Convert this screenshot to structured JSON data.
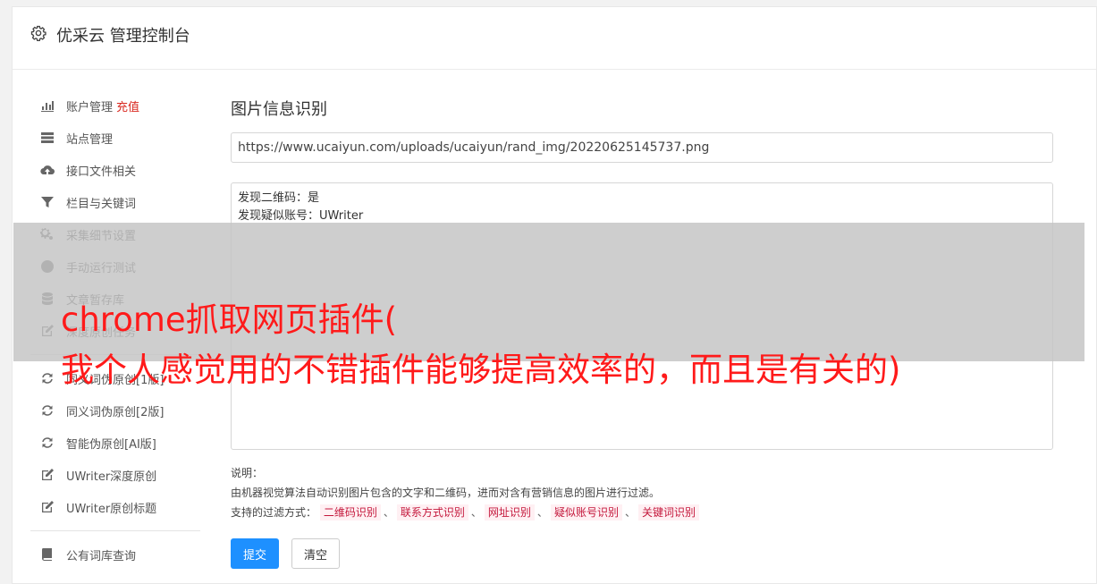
{
  "header": {
    "title": "优采云 管理控制台"
  },
  "sidebar": {
    "group1": [
      {
        "label": "账户管理",
        "badge": "充值",
        "icon": "bar-chart-icon"
      },
      {
        "label": "站点管理",
        "icon": "server-icon"
      },
      {
        "label": "接口文件相关",
        "icon": "cloud-upload-icon"
      },
      {
        "label": "栏目与关键词",
        "icon": "filter-icon"
      },
      {
        "label": "采集细节设置",
        "icon": "cogs-icon"
      },
      {
        "label": "手动运行测试",
        "icon": "play-circle-icon"
      },
      {
        "label": "文章暂存库",
        "icon": "database-icon"
      },
      {
        "label": "深度原创任务",
        "icon": "edit-icon"
      }
    ],
    "group2": [
      {
        "label": "同义词伪原创[1版]",
        "icon": "refresh-icon"
      },
      {
        "label": "同义词伪原创[2版]",
        "icon": "refresh-icon"
      },
      {
        "label": "智能伪原创[AI版]",
        "icon": "refresh-icon"
      },
      {
        "label": "UWriter深度原创",
        "icon": "edit-icon"
      },
      {
        "label": "UWriter原创标题",
        "icon": "edit-icon"
      }
    ],
    "group3": [
      {
        "label": "公有词库查询",
        "icon": "book-icon"
      }
    ]
  },
  "main": {
    "section_title": "图片信息识别",
    "url_value": "https://www.ucaiyun.com/uploads/ucaiyun/rand_img/20220625145737.png",
    "result_lines": [
      "发现二维码：是",
      "发现疑似账号：UWriter"
    ],
    "notes_label": "说明：",
    "notes_desc": "由机器视觉算法自动识别图片包含的文字和二维码，进而对含有营销信息的图片进行过滤。",
    "filter_label": "支持的过滤方式：",
    "filter_tags": [
      "二维码识别",
      "联系方式识别",
      "网址识别",
      "疑似账号识别",
      "关键词识别"
    ],
    "filter_sep": "、",
    "submit_label": "提交",
    "clear_label": "清空"
  },
  "overlay": {
    "line1": "chrome抓取网页插件(",
    "line2": "我个人感觉用的不错插件能够提高效率的，而且是有关的)"
  }
}
